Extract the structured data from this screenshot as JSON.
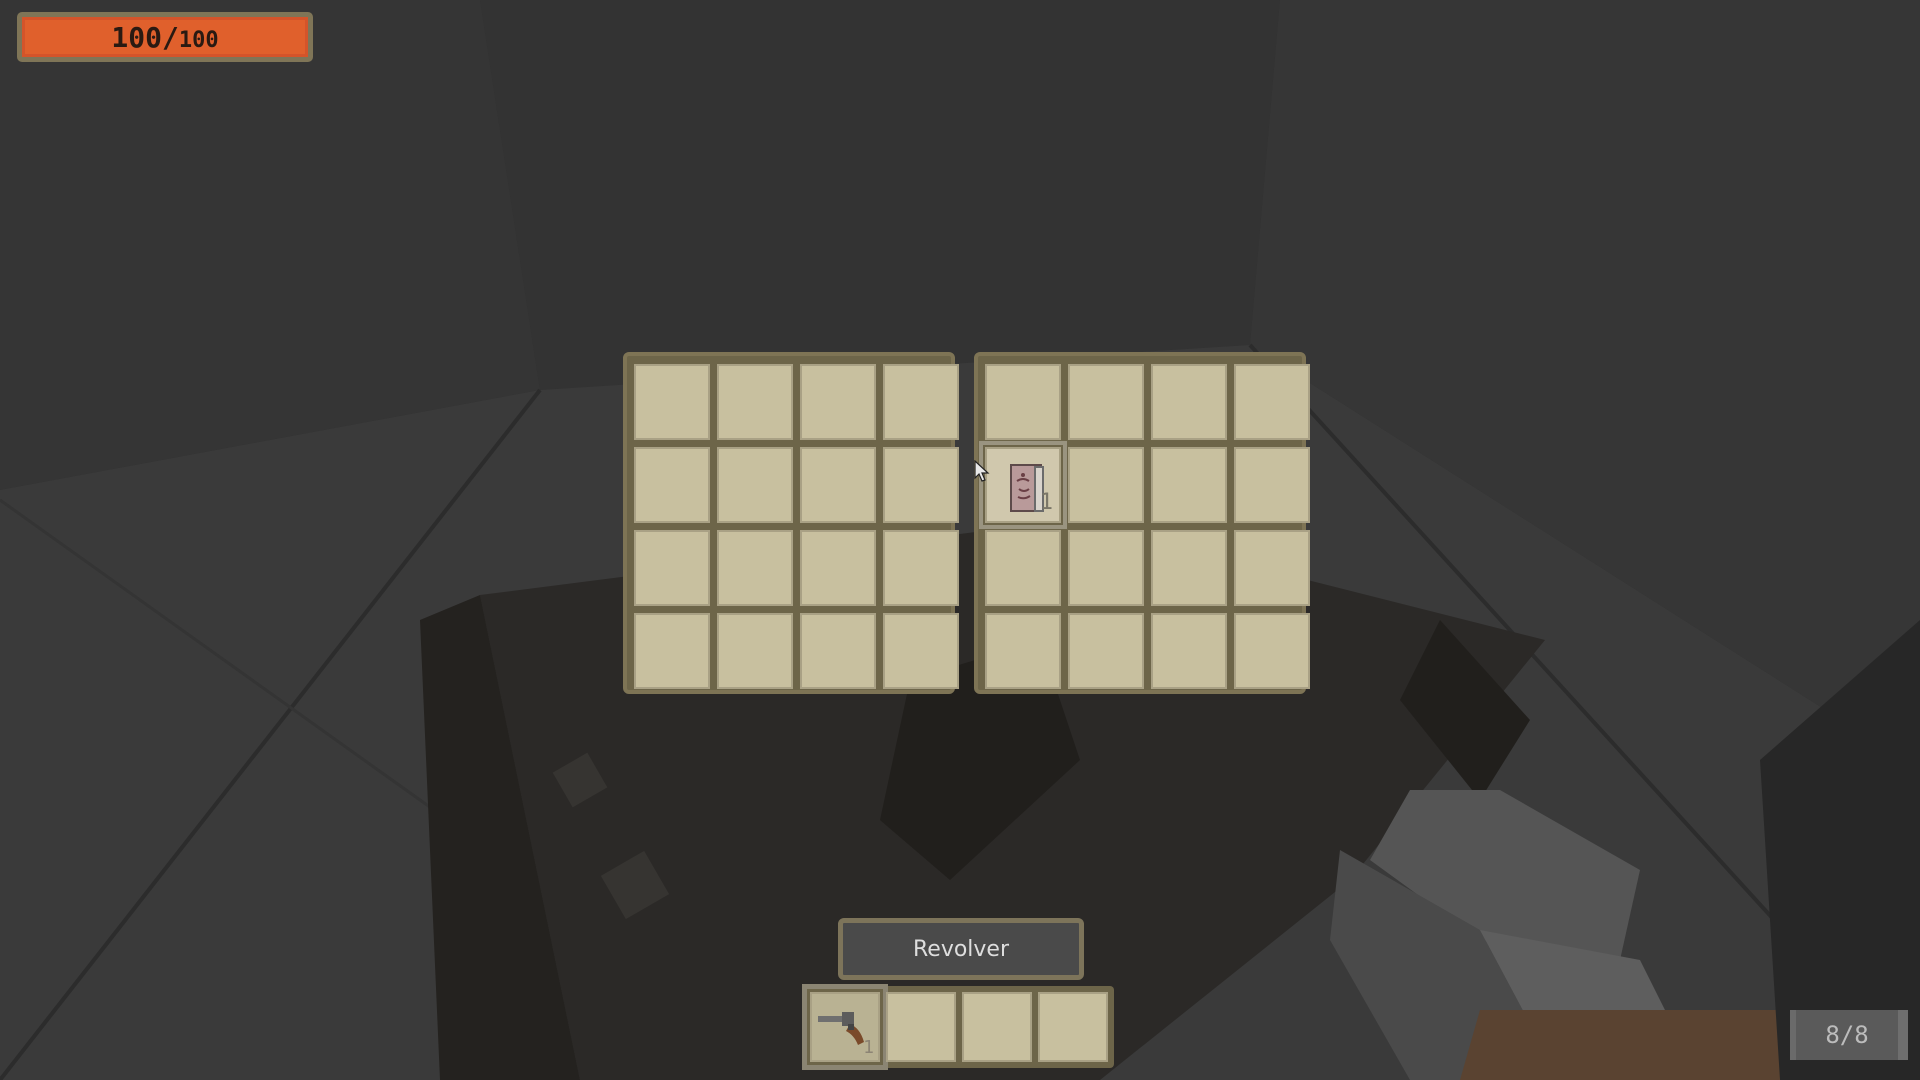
{
  "hud": {
    "health_current": "100",
    "health_separator": "/",
    "health_max": "100",
    "health_fraction": 1.0,
    "ammo": "8/8"
  },
  "storage": {
    "columns_per_panel": 4,
    "rows": 4,
    "panels": 2,
    "items": [
      {
        "panel": "right",
        "row": 1,
        "col": 0,
        "icon": "journal-book-icon",
        "count": "1"
      }
    ]
  },
  "hotbar": {
    "selected_item_name": "Revolver",
    "slots": [
      {
        "icon": "revolver-icon",
        "count": "1",
        "selected": true
      },
      {
        "icon": "",
        "count": "",
        "selected": false
      },
      {
        "icon": "",
        "count": "",
        "selected": false
      },
      {
        "icon": "",
        "count": "",
        "selected": false
      }
    ]
  },
  "colors": {
    "health_fill": "#e0602c",
    "slot_fill": "#c8c09f",
    "frame": "#7e7455",
    "background": "#2f2f2f"
  }
}
